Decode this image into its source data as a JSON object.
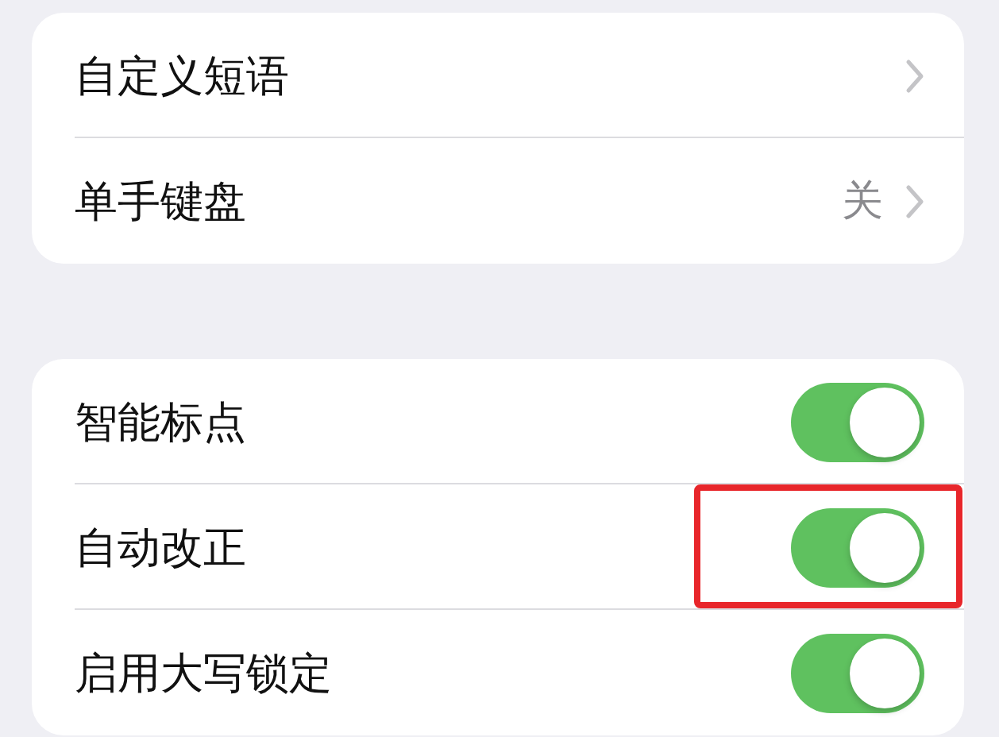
{
  "groups": [
    {
      "rows": [
        {
          "kind": "link",
          "label": "自定义短语"
        },
        {
          "kind": "link",
          "label": "单手键盘",
          "value": "关"
        }
      ]
    },
    {
      "rows": [
        {
          "kind": "toggle",
          "label": "智能标点",
          "on": true,
          "highlighted": false
        },
        {
          "kind": "toggle",
          "label": "自动改正",
          "on": true,
          "highlighted": true
        },
        {
          "kind": "toggle",
          "label": "启用大写锁定",
          "on": true,
          "highlighted": false
        }
      ]
    }
  ]
}
